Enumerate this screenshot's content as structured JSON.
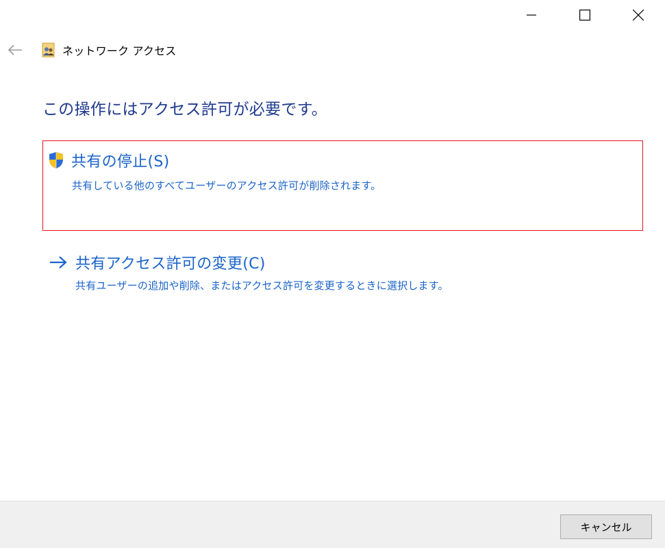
{
  "window": {
    "title": "ネットワーク アクセス",
    "controls": [
      "minimize",
      "maximize",
      "close"
    ]
  },
  "main": {
    "heading": "この操作にはアクセス許可が必要です。",
    "options": [
      {
        "title": "共有の停止(S)",
        "description": "共有している他のすべてユーザーのアクセス許可が削除されます。",
        "icon": "uac-shield-icon"
      },
      {
        "title": "共有アクセス許可の変更(C)",
        "description": "共有ユーザーの追加や削除、またはアクセス許可を変更するときに選択します。",
        "icon": "arrow-right-icon"
      }
    ]
  },
  "footer": {
    "cancel_label": "キャンセル"
  },
  "colors": {
    "heading": "#1e3a8c",
    "link": "#1a63c9",
    "highlight_border": "#e0141e",
    "footer_bg": "#f0f0f0"
  }
}
